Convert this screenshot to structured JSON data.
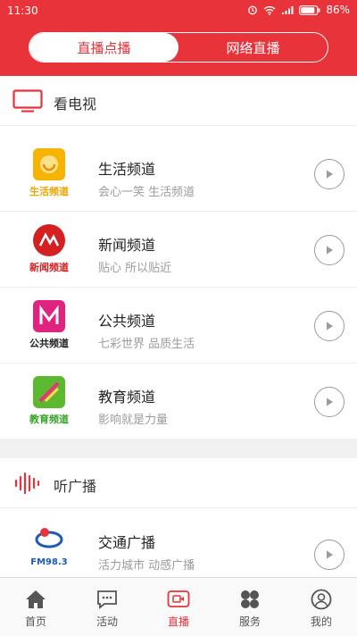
{
  "status_bar": {
    "time": "11:30",
    "battery": "86%",
    "icons": [
      "alarm-icon",
      "wifi-icon",
      "signal-icon",
      "battery-icon"
    ]
  },
  "segment": {
    "tabs": [
      {
        "label": "直播点播",
        "active": true
      },
      {
        "label": "网络直播",
        "active": false
      }
    ]
  },
  "tv_section": {
    "title": "看电视",
    "icon": "tv-icon",
    "channels": [
      {
        "name": "生活频道",
        "slogan": "会心一笑 生活频道",
        "logo_label": "生活频道",
        "logo_color": "#f0a400"
      },
      {
        "name": "新闻频道",
        "slogan": "贴心 所以贴近",
        "logo_label": "新闻频道",
        "logo_color": "#d42020"
      },
      {
        "name": "公共频道",
        "slogan": "七彩世界 品质生活",
        "logo_label": "公共频道",
        "logo_color": "#222222"
      },
      {
        "name": "教育频道",
        "slogan": "影响就是力量",
        "logo_label": "教育频道",
        "logo_color": "#3aa32c"
      }
    ]
  },
  "radio_section": {
    "title": "听广播",
    "icon": "sound-wave-icon",
    "stations": [
      {
        "name": "交通广播",
        "slogan": "活力城市 动感广播",
        "logo_label": "FM98.3"
      }
    ]
  },
  "tab_bar": {
    "items": [
      {
        "label": "首页",
        "icon": "home-icon",
        "active": false
      },
      {
        "label": "活动",
        "icon": "chat-icon",
        "active": false
      },
      {
        "label": "直播",
        "icon": "live-video-icon",
        "active": true
      },
      {
        "label": "服务",
        "icon": "clover-icon",
        "active": false
      },
      {
        "label": "我的",
        "icon": "user-icon",
        "active": false
      }
    ]
  },
  "colors": {
    "brand": "#e8333a",
    "text_secondary": "#9c9c9c"
  }
}
